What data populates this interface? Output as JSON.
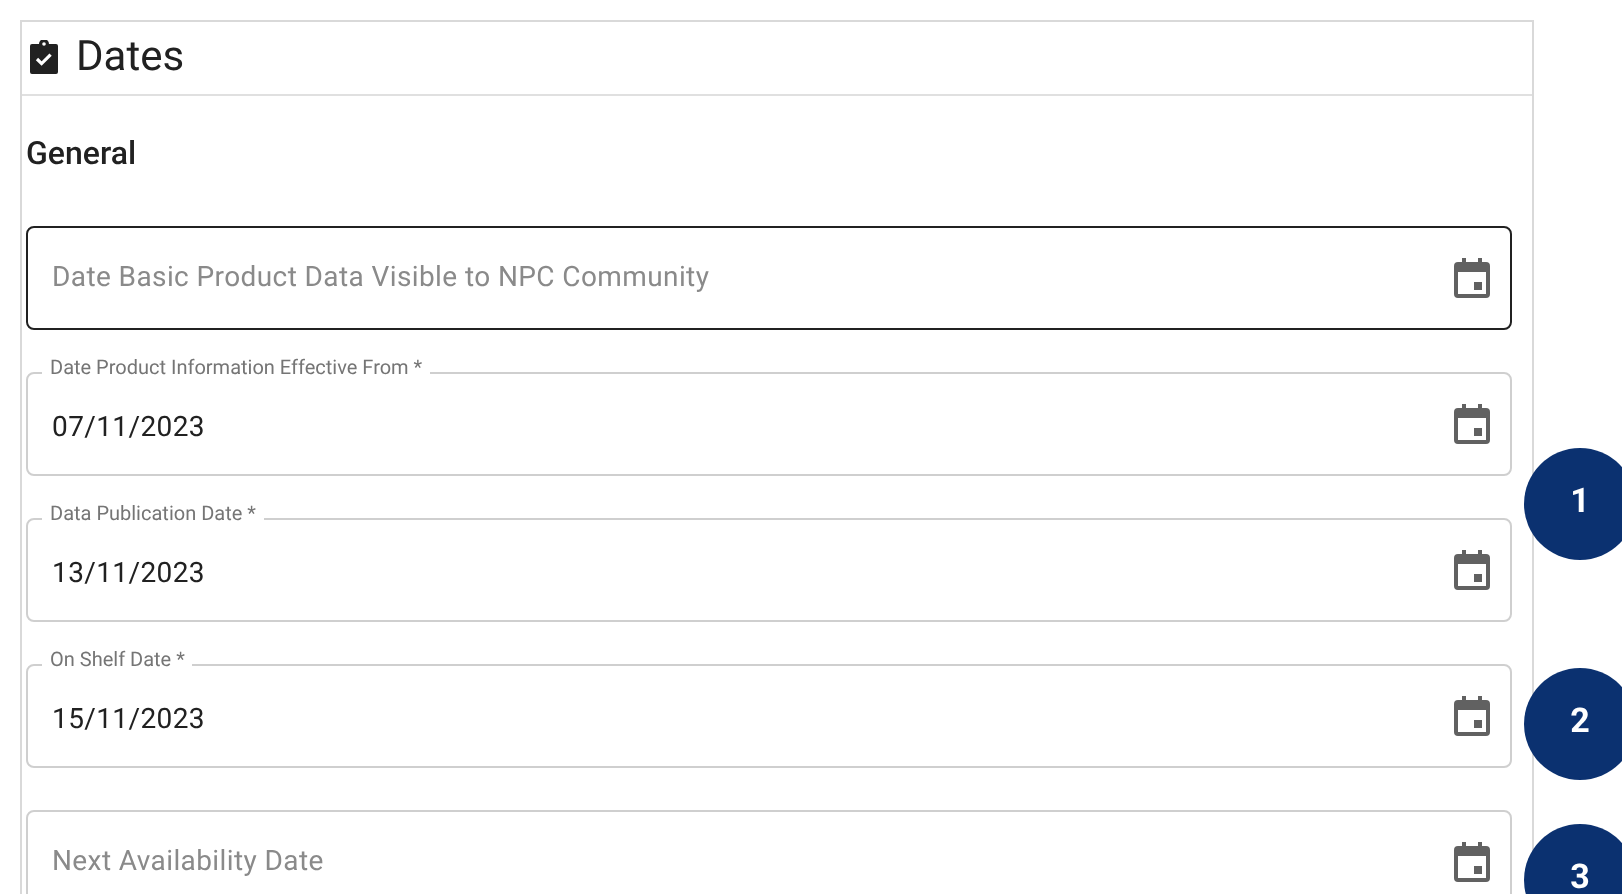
{
  "section": {
    "title": "Dates",
    "subtitle": "General"
  },
  "fields": [
    {
      "placeholder": "Date Basic Product Data Visible to NPC Community",
      "focused": true
    },
    {
      "label": "Date Product Information Effective From *",
      "value": "07/11/2023",
      "focused": false
    },
    {
      "label": "Data Publication Date *",
      "value": "13/11/2023",
      "focused": false
    },
    {
      "label": "On Shelf Date *",
      "value": "15/11/2023",
      "focused": false
    },
    {
      "placeholder": "Next Availability Date",
      "focused": false
    }
  ],
  "callouts": [
    {
      "number": "1"
    },
    {
      "number": "2"
    },
    {
      "number": "3"
    }
  ]
}
